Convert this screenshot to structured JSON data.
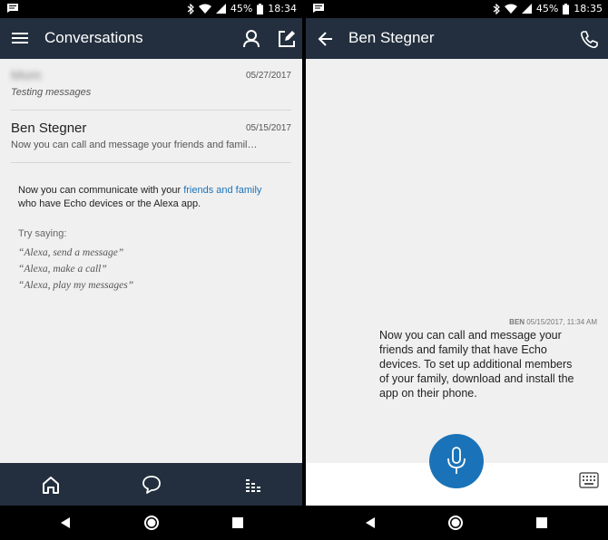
{
  "left": {
    "status": {
      "battery": "45%",
      "time": "18:34"
    },
    "appbar": {
      "title": "Conversations",
      "icons": [
        "menu-icon",
        "person-icon",
        "compose-icon"
      ]
    },
    "conversations": [
      {
        "name": "Mom",
        "date": "05/27/2017",
        "preview": "Testing messages",
        "name_blurred": true
      },
      {
        "name": "Ben Stegner",
        "date": "05/15/2017",
        "preview": "Now you can call and message your friends and famil…",
        "name_blurred": false
      }
    ],
    "info": {
      "text_before": "Now you can communicate with your ",
      "link": "friends and family",
      "text_after": "who have Echo devices or the Alexa app.",
      "try_saying": "Try saying:",
      "quotes": [
        "“Alexa, send a message”",
        "“Alexa, make a call”",
        "“Alexa, play my messages”"
      ]
    },
    "bottom_nav": [
      "home-icon",
      "conversation-icon",
      "equalizer-icon"
    ]
  },
  "right": {
    "status": {
      "battery": "45%",
      "time": "18:35"
    },
    "appbar": {
      "title": "Ben Stegner",
      "icons": [
        "back-arrow-icon",
        "phone-icon"
      ]
    },
    "message": {
      "sender": "BEN",
      "timestamp": "05/15/2017, 11:34 AM",
      "lines": [
        "Now you can call and message your",
        "friends and family that have Echo",
        "devices. To set up additional members",
        "of your family, download and install the",
        "app on their phone."
      ]
    },
    "input_icons": [
      "microphone-icon",
      "keyboard-icon"
    ]
  },
  "colors": {
    "appbar": "#232f3e",
    "accent": "#1a73b8",
    "background": "#f0f0f0"
  }
}
